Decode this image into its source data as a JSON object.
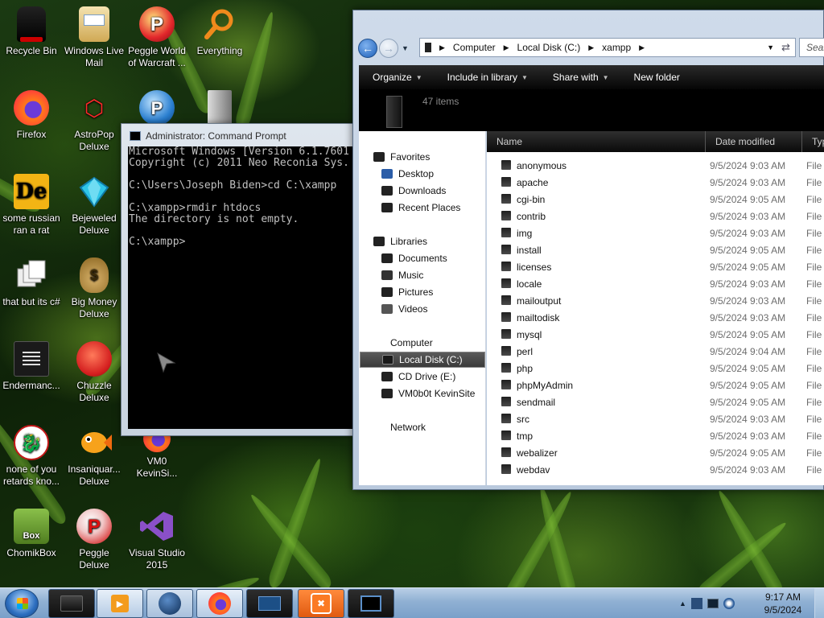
{
  "desktop": {
    "icons": [
      {
        "label": "Recycle Bin",
        "icon": "recycle-bin-icon"
      },
      {
        "label": "Windows Live Mail",
        "icon": "windows-live-mail-icon"
      },
      {
        "label": "Peggle World of Warcraft ...",
        "icon": "peggle-wow-icon"
      },
      {
        "label": "Everything",
        "icon": "everything-search-icon"
      },
      {
        "label": "Firefox",
        "icon": "firefox-icon"
      },
      {
        "label": "AstroPop Deluxe",
        "icon": "astropop-icon"
      },
      {
        "label": "some russian ran a rat",
        "icon": "de-icon"
      },
      {
        "label": "Bejeweled Deluxe",
        "icon": "bejeweled-icon"
      },
      {
        "label": "that but its c#",
        "icon": "windows-stack-icon"
      },
      {
        "label": "Big Money Deluxe",
        "icon": "money-bag-icon"
      },
      {
        "label": "Endermanc...",
        "icon": "enderman-icon"
      },
      {
        "label": "Chuzzle Deluxe",
        "icon": "chuzzle-icon"
      },
      {
        "label": "none of you retards kno...",
        "icon": "red-dragon-icon"
      },
      {
        "label": "Insaniquar... Deluxe",
        "icon": "insaniquarium-icon"
      },
      {
        "label": "VM0 KevinSi...",
        "icon": "firefox-vm-icon"
      },
      {
        "label": "ChomikBox",
        "icon": "chomikbox-icon"
      },
      {
        "label": "Peggle Deluxe",
        "icon": "peggle-icon"
      },
      {
        "label": "Visual Studio 2015",
        "icon": "visual-studio-icon"
      }
    ]
  },
  "cmd": {
    "title": "Administrator: Command Prompt",
    "lines": [
      "Microsoft Windows [Version 6.1.7601",
      "Copyright (c) 2011 Neo Reconia Sys.",
      "",
      "C:\\Users\\Joseph Biden>cd C:\\xampp",
      "",
      "C:\\xampp>rmdir htdocs",
      "The directory is not empty.",
      "",
      "C:\\xampp>"
    ]
  },
  "explorer": {
    "address": {
      "segments": [
        "Computer",
        "Local Disk (C:)",
        "xampp"
      ]
    },
    "search_placeholder": "Searc",
    "toolbar": {
      "organize": "Organize",
      "include": "Include in library",
      "share": "Share with",
      "new_folder": "New folder"
    },
    "item_count": "47 items",
    "columns": {
      "name": "Name",
      "date": "Date modified",
      "type": "Typ"
    },
    "nav": {
      "favorites": "Favorites",
      "desktop": "Desktop",
      "downloads": "Downloads",
      "recent": "Recent Places",
      "libraries": "Libraries",
      "documents": "Documents",
      "music": "Music",
      "pictures": "Pictures",
      "videos": "Videos",
      "computer": "Computer",
      "local_disk": "Local Disk (C:)",
      "cd_drive": "CD Drive (E:)",
      "vm": "VM0b0t KevinSite",
      "network": "Network"
    },
    "files": [
      {
        "name": "anonymous",
        "date": "9/5/2024 9:03 AM",
        "type": "File"
      },
      {
        "name": "apache",
        "date": "9/5/2024 9:03 AM",
        "type": "File"
      },
      {
        "name": "cgi-bin",
        "date": "9/5/2024 9:05 AM",
        "type": "File"
      },
      {
        "name": "contrib",
        "date": "9/5/2024 9:03 AM",
        "type": "File"
      },
      {
        "name": "img",
        "date": "9/5/2024 9:03 AM",
        "type": "File"
      },
      {
        "name": "install",
        "date": "9/5/2024 9:05 AM",
        "type": "File"
      },
      {
        "name": "licenses",
        "date": "9/5/2024 9:05 AM",
        "type": "File"
      },
      {
        "name": "locale",
        "date": "9/5/2024 9:03 AM",
        "type": "File"
      },
      {
        "name": "mailoutput",
        "date": "9/5/2024 9:03 AM",
        "type": "File"
      },
      {
        "name": "mailtodisk",
        "date": "9/5/2024 9:03 AM",
        "type": "File"
      },
      {
        "name": "mysql",
        "date": "9/5/2024 9:05 AM",
        "type": "File"
      },
      {
        "name": "perl",
        "date": "9/5/2024 9:04 AM",
        "type": "File"
      },
      {
        "name": "php",
        "date": "9/5/2024 9:05 AM",
        "type": "File"
      },
      {
        "name": "phpMyAdmin",
        "date": "9/5/2024 9:05 AM",
        "type": "File"
      },
      {
        "name": "sendmail",
        "date": "9/5/2024 9:05 AM",
        "type": "File"
      },
      {
        "name": "src",
        "date": "9/5/2024 9:03 AM",
        "type": "File"
      },
      {
        "name": "tmp",
        "date": "9/5/2024 9:03 AM",
        "type": "File"
      },
      {
        "name": "webalizer",
        "date": "9/5/2024 9:05 AM",
        "type": "File"
      },
      {
        "name": "webdav",
        "date": "9/5/2024 9:03 AM",
        "type": "File"
      }
    ]
  },
  "taskbar": {
    "clock_time": "9:17 AM",
    "clock_date": "9/5/2024",
    "tray_icons": [
      "show-hidden-icons-icon",
      "network-icon",
      "monitor-icon",
      "speaker-icon"
    ],
    "buttons": [
      "folder-icon",
      "media-player-icon",
      "globe-icon",
      "firefox-icon",
      "terminal-icon",
      "xampp-icon",
      "command-prompt-icon"
    ]
  },
  "colors": {
    "accent": "#1d5fb8",
    "console_bg": "#000000",
    "console_text": "#c0c0c0",
    "taskbar": "#8fb0d3"
  }
}
